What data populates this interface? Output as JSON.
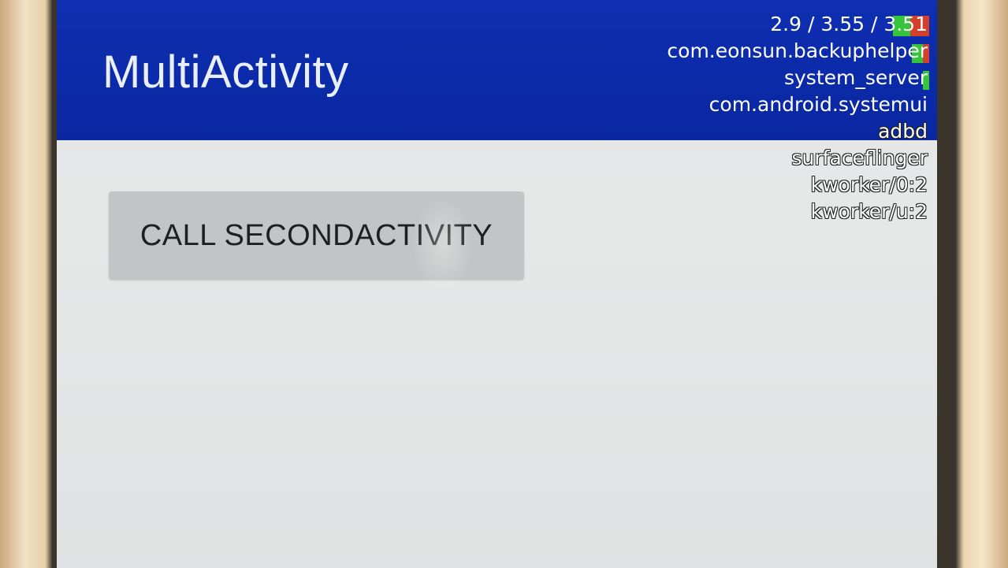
{
  "app_bar": {
    "title": "MultiActivity",
    "background": "#0f2fb2"
  },
  "load_overlay": {
    "load_average": "2.9 / 3.55 / 3.51",
    "processes": [
      "com.eonsun.backuphelper",
      "system_server",
      "com.android.systemui",
      "adbd",
      "surfaceflinger",
      "kworker/0:2",
      "kworker/u:2"
    ],
    "bar_colors": {
      "user": "#35c43a",
      "kernel": "#d3402c"
    }
  },
  "main": {
    "call_button_label": "CALL SECONDACTIVITY"
  }
}
